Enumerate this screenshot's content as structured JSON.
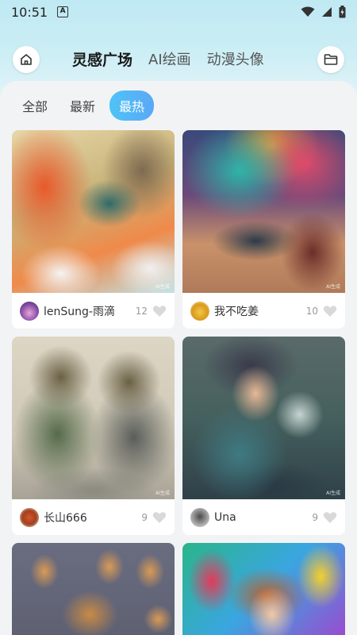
{
  "status": {
    "time": "10:51",
    "a_icon_label": "A"
  },
  "header": {
    "tabs": [
      {
        "label": "灵感广场",
        "active": true
      },
      {
        "label": "AI绘画",
        "active": false
      },
      {
        "label": "动漫头像",
        "active": false
      }
    ]
  },
  "filters": [
    {
      "label": "全部",
      "active": false
    },
    {
      "label": "最新",
      "active": false
    },
    {
      "label": "最热",
      "active": true
    }
  ],
  "cards": [
    {
      "user": "lenSung-雨滴",
      "likes": "12",
      "badge": "AI生成"
    },
    {
      "user": "我不吃姜",
      "likes": "10",
      "badge": "AI生成"
    },
    {
      "user": "长山666",
      "likes": "9",
      "badge": "AI生成"
    },
    {
      "user": "Una",
      "likes": "9",
      "badge": "AI生成"
    }
  ],
  "colors": {
    "accent": "#4fc3f7",
    "heart": "#d9d9d9"
  }
}
